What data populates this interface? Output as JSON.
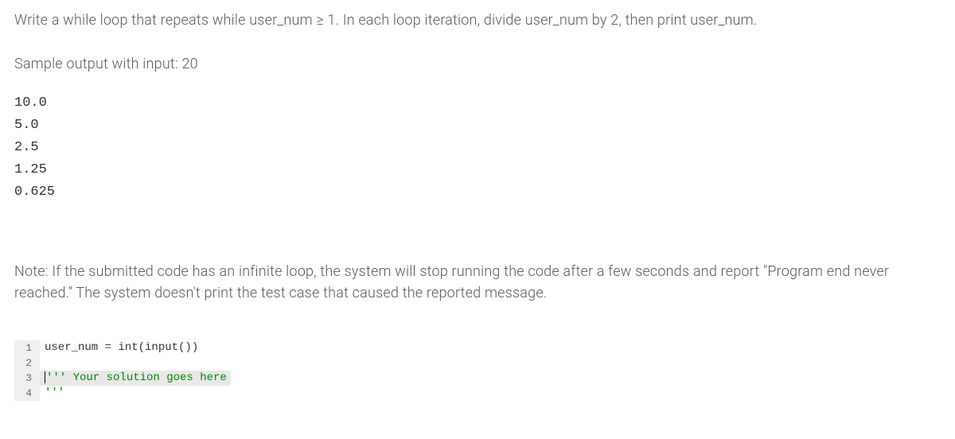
{
  "prompt": {
    "instruction": "Write a while loop that repeats while user_num ≥ 1. In each loop iteration, divide user_num by 2, then print user_num.",
    "sample_label": "Sample output with input: 20",
    "sample_output": "10.0\n5.0\n2.5\n1.25\n0.625",
    "note": "Note: If the submitted code has an infinite loop, the system will stop running the code after a few seconds and report \"Program end never reached.\" The system doesn't print the test case that caused the reported message."
  },
  "editor": {
    "lines": [
      {
        "num": "1",
        "tokens": [
          {
            "t": "user_num = int(input())",
            "c": "tk-default"
          }
        ],
        "highlighted": false,
        "cursor": false
      },
      {
        "num": "2",
        "tokens": [],
        "highlighted": false,
        "cursor": false
      },
      {
        "num": "3",
        "tokens": [
          {
            "t": "''' Your solution goes here '''",
            "c": "tk-string"
          }
        ],
        "highlighted": true,
        "cursor": true
      },
      {
        "num": "4",
        "tokens": [],
        "highlighted": false,
        "cursor": false
      }
    ]
  }
}
